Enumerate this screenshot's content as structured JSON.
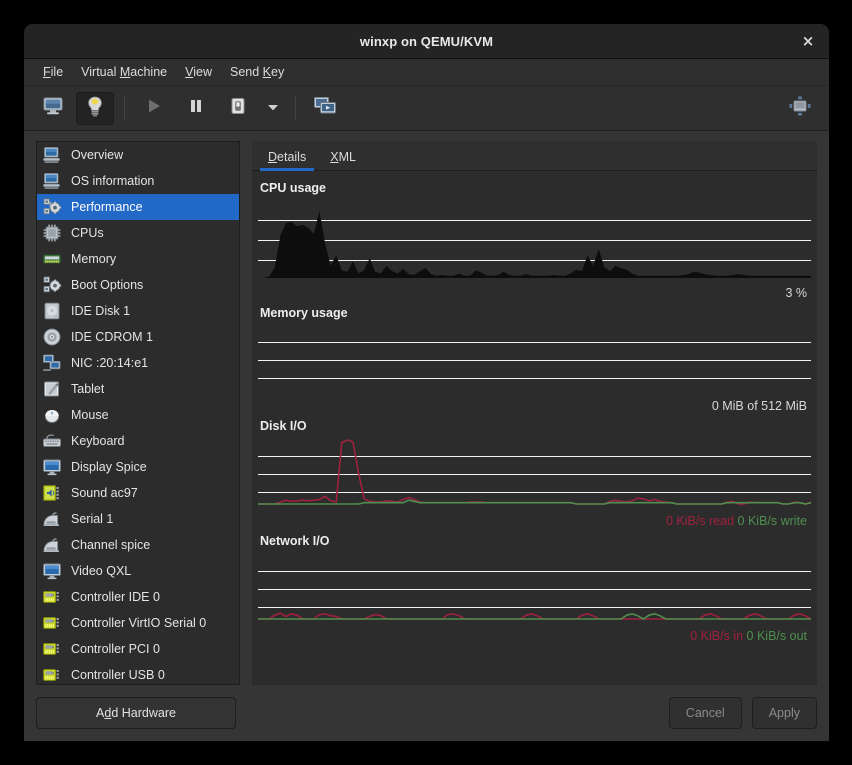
{
  "window": {
    "title": "winxp on QEMU/KVM",
    "close_label": "×"
  },
  "menubar": {
    "items": [
      {
        "label": "File",
        "mnemonic": "F"
      },
      {
        "label": "Virtual Machine",
        "mnemonic": "M"
      },
      {
        "label": "View",
        "mnemonic": "V"
      },
      {
        "label": "Send Key",
        "mnemonic": "K"
      }
    ]
  },
  "toolbar": {
    "buttons": [
      {
        "name": "show-console-button",
        "icon": "monitor-icon",
        "state": "normal"
      },
      {
        "name": "show-details-button",
        "icon": "lightbulb-icon",
        "state": "pressed"
      },
      {
        "name": "run-button",
        "icon": "play-icon",
        "state": "disabled"
      },
      {
        "name": "pause-button",
        "icon": "pause-icon",
        "state": "normal"
      },
      {
        "name": "shutdown-button",
        "icon": "power-icon",
        "state": "normal"
      },
      {
        "name": "shutdown-menu-button",
        "icon": "chevron-down-icon",
        "state": "normal"
      },
      {
        "name": "snapshots-button",
        "icon": "snapshots-icon",
        "state": "normal"
      },
      {
        "name": "fullscreen-button",
        "icon": "fullscreen-icon",
        "state": "normal"
      }
    ]
  },
  "sidebar": {
    "selected_index": 2,
    "items": [
      {
        "label": "Overview",
        "icon": "computer-icon"
      },
      {
        "label": "OS information",
        "icon": "computer-icon"
      },
      {
        "label": "Performance",
        "icon": "performance-icon"
      },
      {
        "label": "CPUs",
        "icon": "cpu-chip-icon"
      },
      {
        "label": "Memory",
        "icon": "memory-icon"
      },
      {
        "label": "Boot Options",
        "icon": "boot-options-icon"
      },
      {
        "label": "IDE Disk 1",
        "icon": "harddisk-icon"
      },
      {
        "label": "IDE CDROM 1",
        "icon": "cdrom-icon"
      },
      {
        "label": "NIC :20:14:e1",
        "icon": "network-icon"
      },
      {
        "label": "Tablet",
        "icon": "tablet-icon"
      },
      {
        "label": "Mouse",
        "icon": "mouse-icon"
      },
      {
        "label": "Keyboard",
        "icon": "keyboard-icon"
      },
      {
        "label": "Display Spice",
        "icon": "display-icon"
      },
      {
        "label": "Sound ac97",
        "icon": "sound-icon"
      },
      {
        "label": "Serial 1",
        "icon": "serial-icon"
      },
      {
        "label": "Channel spice",
        "icon": "serial-icon"
      },
      {
        "label": "Video QXL",
        "icon": "display-icon"
      },
      {
        "label": "Controller IDE 0",
        "icon": "controller-icon"
      },
      {
        "label": "Controller VirtIO Serial 0",
        "icon": "controller-icon"
      },
      {
        "label": "Controller PCI 0",
        "icon": "controller-icon"
      },
      {
        "label": "Controller USB 0",
        "icon": "controller-icon"
      }
    ]
  },
  "tabs": {
    "active_index": 0,
    "items": [
      {
        "label": "Details",
        "mnemonic": "D"
      },
      {
        "label": "XML",
        "mnemonic": "X"
      }
    ]
  },
  "sections": {
    "cpu": {
      "title": "CPU usage",
      "value": "3 %"
    },
    "memory": {
      "title": "Memory usage",
      "value": "0 MiB of 512 MiB"
    },
    "disk": {
      "title": "Disk I/O",
      "read_value": "0 KiB/s read",
      "write_value": "0 KiB/s write"
    },
    "network": {
      "title": "Network I/O",
      "in_value": "0 KiB/s in",
      "out_value": "0 KiB/s out"
    }
  },
  "footer": {
    "add_hardware_label": "Add Hardware",
    "add_hardware_mnemonic": "d",
    "cancel_label": "Cancel",
    "apply_label": "Apply",
    "cancel_enabled": false,
    "apply_enabled": false
  },
  "colors": {
    "accent": "#2268c7",
    "window_bg": "#353535",
    "panel_bg": "#2c2c2c",
    "titlebar_bg": "#242424",
    "graph_fill": "#0d0d0d",
    "gridline": "#f2f2f2",
    "read_color": "#a0213f",
    "write_color": "#4f8f4f"
  },
  "chart_data": [
    {
      "type": "area",
      "name": "cpu-usage-graph",
      "title": "CPU usage",
      "ylabel": "percent",
      "ylim": [
        0,
        100
      ],
      "gridlines": [
        25,
        50,
        75
      ],
      "current_value": 3,
      "unit": "%",
      "series": [
        {
          "name": "CPU usage",
          "color": "#0d0d0d",
          "values": [
            0,
            0,
            2,
            14,
            56,
            72,
            74,
            68,
            70,
            66,
            58,
            88,
            46,
            16,
            30,
            10,
            8,
            22,
            6,
            10,
            26,
            8,
            6,
            16,
            9,
            6,
            12,
            5,
            4,
            9,
            13,
            5,
            3,
            4,
            3,
            3,
            6,
            3,
            3,
            10,
            7,
            3,
            3,
            4,
            8,
            4,
            3,
            3,
            5,
            3,
            3,
            3,
            3,
            4,
            3,
            3,
            6,
            11,
            9,
            30,
            16,
            38,
            14,
            9,
            16,
            13,
            11,
            6,
            3,
            3,
            3,
            3,
            3,
            3,
            3,
            3,
            4,
            5,
            8,
            7,
            5,
            4,
            3,
            3,
            3,
            4,
            5,
            4,
            3,
            3,
            3,
            3,
            3,
            3,
            3,
            3,
            3,
            3,
            3,
            3
          ]
        }
      ]
    },
    {
      "type": "line",
      "name": "memory-usage-graph",
      "title": "Memory usage",
      "ylabel": "MiB",
      "ylim": [
        0,
        512
      ],
      "gridlines": [
        128,
        256,
        384
      ],
      "current_value": 0,
      "total": 512,
      "unit": "MiB",
      "series": [
        {
          "name": "Memory usage",
          "color": "#0d0d0d",
          "values": [
            0,
            0,
            0,
            0,
            0,
            0,
            0,
            0,
            0,
            0,
            0,
            0,
            0,
            0,
            0,
            0,
            0,
            0,
            0,
            0,
            0,
            0,
            0,
            0,
            0,
            0,
            0,
            0,
            0,
            0,
            0,
            0,
            0,
            0,
            0,
            0,
            0,
            0,
            0,
            0,
            0,
            0,
            0,
            0,
            0,
            0,
            0,
            0,
            0,
            0,
            0,
            0,
            0,
            0,
            0,
            0,
            0,
            0,
            0,
            0,
            0,
            0,
            0,
            0,
            0,
            0,
            0,
            0,
            0,
            0,
            0,
            0,
            0,
            0,
            0,
            0,
            0,
            0,
            0,
            0,
            0,
            0,
            0,
            0,
            0,
            0,
            0,
            0,
            0,
            0,
            0,
            0,
            0,
            0,
            0,
            0,
            0,
            0,
            0,
            0
          ]
        }
      ]
    },
    {
      "type": "line",
      "name": "disk-io-graph",
      "title": "Disk I/O",
      "ylabel": "KiB/s",
      "gridlines": [
        25,
        50,
        75
      ],
      "series": [
        {
          "name": "read",
          "color": "#a0213f",
          "current": "0 KiB/s read",
          "values": [
            0,
            0,
            0,
            0,
            3,
            6,
            4,
            5,
            6,
            5,
            6,
            7,
            12,
            5,
            3,
            96,
            100,
            97,
            48,
            8,
            4,
            3,
            3,
            5,
            4,
            3,
            7,
            10,
            7,
            3,
            2,
            2,
            2,
            2,
            2,
            2,
            2,
            2,
            3,
            3,
            3,
            2,
            2,
            2,
            2,
            2,
            2,
            2,
            2,
            2,
            2,
            2,
            2,
            2,
            2,
            2,
            2,
            0,
            0,
            0,
            0,
            0,
            0,
            4,
            6,
            4,
            3,
            5,
            9,
            8,
            5,
            7,
            4,
            3,
            2,
            0,
            0,
            0,
            0,
            0,
            0,
            0,
            0,
            0,
            3,
            4,
            0,
            0,
            3,
            2,
            2,
            2,
            2,
            2,
            0,
            0,
            3,
            2,
            0,
            3
          ]
        },
        {
          "name": "write",
          "color": "#4f8f4f",
          "current": "0 KiB/s write",
          "values": [
            0,
            0,
            0,
            0,
            0,
            0,
            0,
            0,
            0,
            0,
            0,
            0,
            0,
            0,
            0,
            0,
            0,
            0,
            0,
            2,
            2,
            2,
            2,
            2,
            2,
            2,
            2,
            6,
            4,
            2,
            2,
            2,
            2,
            2,
            2,
            2,
            2,
            2,
            2,
            2,
            2,
            2,
            2,
            2,
            2,
            2,
            2,
            2,
            2,
            2,
            2,
            2,
            2,
            2,
            2,
            2,
            2,
            0,
            0,
            0,
            0,
            0,
            0,
            2,
            2,
            2,
            2,
            2,
            2,
            2,
            2,
            2,
            2,
            2,
            2,
            0,
            0,
            0,
            0,
            0,
            0,
            0,
            0,
            0,
            2,
            2,
            2,
            2,
            2,
            2,
            2,
            2,
            2,
            2,
            0,
            0,
            2,
            2,
            0,
            2
          ]
        }
      ]
    },
    {
      "type": "line",
      "name": "network-io-graph",
      "title": "Network I/O",
      "ylabel": "KiB/s",
      "gridlines": [
        25,
        50,
        75
      ],
      "series": [
        {
          "name": "in",
          "color": "#a0213f",
          "current": "0 KiB/s in",
          "values": [
            0,
            0,
            0,
            6,
            9,
            4,
            8,
            6,
            0,
            0,
            0,
            7,
            8,
            5,
            4,
            0,
            0,
            0,
            0,
            0,
            4,
            7,
            5,
            0,
            0,
            0,
            0,
            0,
            0,
            0,
            0,
            0,
            0,
            0,
            7,
            8,
            5,
            0,
            0,
            0,
            0,
            0,
            0,
            0,
            0,
            0,
            0,
            0,
            6,
            8,
            5,
            0,
            0,
            0,
            0,
            0,
            0,
            0,
            6,
            8,
            5,
            0,
            0,
            0,
            0,
            0,
            0,
            0,
            0,
            0,
            0,
            0,
            0,
            0,
            0,
            0,
            0,
            0,
            0,
            0,
            6,
            8,
            5,
            0,
            0,
            0,
            0,
            0,
            6,
            8,
            5,
            0,
            0,
            0,
            0,
            0,
            6,
            8,
            5,
            0
          ]
        },
        {
          "name": "out",
          "color": "#4f8f4f",
          "current": "0 KiB/s out",
          "values": [
            0,
            0,
            0,
            0,
            0,
            0,
            0,
            0,
            0,
            0,
            0,
            0,
            0,
            0,
            0,
            0,
            0,
            0,
            0,
            0,
            0,
            0,
            0,
            0,
            0,
            0,
            0,
            0,
            0,
            0,
            0,
            0,
            0,
            0,
            0,
            0,
            0,
            0,
            0,
            0,
            0,
            0,
            0,
            0,
            0,
            0,
            0,
            0,
            0,
            0,
            0,
            0,
            0,
            0,
            0,
            0,
            0,
            0,
            0,
            0,
            0,
            0,
            0,
            0,
            0,
            0,
            6,
            8,
            5,
            0,
            6,
            8,
            5,
            0,
            0,
            0,
            0,
            0,
            0,
            0,
            0,
            0,
            0,
            0,
            0,
            0,
            0,
            0,
            0,
            0,
            0,
            0,
            0,
            0,
            0,
            0,
            0,
            0,
            0,
            0
          ]
        }
      ]
    }
  ]
}
